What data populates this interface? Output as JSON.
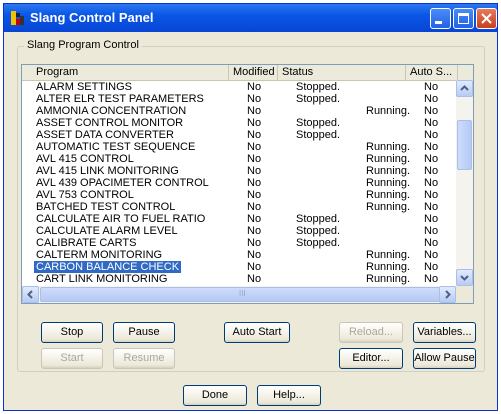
{
  "window": {
    "title": "Slang Control Panel"
  },
  "group": {
    "label": "Slang Program Control"
  },
  "table": {
    "columns": [
      "Program",
      "Modified",
      "Status",
      "Auto S..."
    ],
    "rows": [
      {
        "program": "ALARM SETTINGS",
        "modified": "No",
        "stopped": "Stopped.",
        "running": "",
        "auto": "No"
      },
      {
        "program": "ALTER ELR TEST PARAMETERS",
        "modified": "No",
        "stopped": "Stopped.",
        "running": "",
        "auto": "No"
      },
      {
        "program": "AMMONIA CONCENTRATION",
        "modified": "No",
        "stopped": "",
        "running": "Running.",
        "auto": "No"
      },
      {
        "program": "ASSET CONTROL MONITOR",
        "modified": "No",
        "stopped": "Stopped.",
        "running": "",
        "auto": "No"
      },
      {
        "program": "ASSET DATA CONVERTER",
        "modified": "No",
        "stopped": "Stopped.",
        "running": "",
        "auto": "No"
      },
      {
        "program": "AUTOMATIC TEST SEQUENCE",
        "modified": "No",
        "stopped": "",
        "running": "Running.",
        "auto": "No"
      },
      {
        "program": "AVL 415 CONTROL",
        "modified": "No",
        "stopped": "",
        "running": "Running.",
        "auto": "No"
      },
      {
        "program": "AVL 415 LINK MONITORING",
        "modified": "No",
        "stopped": "",
        "running": "Running.",
        "auto": "No"
      },
      {
        "program": "AVL 439 OPACIMETER CONTROL",
        "modified": "No",
        "stopped": "",
        "running": "Running.",
        "auto": "No"
      },
      {
        "program": "AVL 753 CONTROL",
        "modified": "No",
        "stopped": "",
        "running": "Running.",
        "auto": "No"
      },
      {
        "program": "BATCHED TEST CONTROL",
        "modified": "No",
        "stopped": "",
        "running": "Running.",
        "auto": "No"
      },
      {
        "program": "CALCULATE AIR TO FUEL RATIO",
        "modified": "No",
        "stopped": "Stopped.",
        "running": "",
        "auto": "No"
      },
      {
        "program": "CALCULATE ALARM LEVEL",
        "modified": "No",
        "stopped": "Stopped.",
        "running": "",
        "auto": "No"
      },
      {
        "program": "CALIBRATE CARTS",
        "modified": "No",
        "stopped": "Stopped.",
        "running": "",
        "auto": "No"
      },
      {
        "program": "CALTERM MONITORING",
        "modified": "No",
        "stopped": "",
        "running": "Running.",
        "auto": "No"
      },
      {
        "program": "CARBON BALANCE CHECK",
        "modified": "No",
        "stopped": "",
        "running": "Running.",
        "auto": "No"
      },
      {
        "program": "CART LINK MONITORING",
        "modified": "No",
        "stopped": "",
        "running": "Running.",
        "auto": "No"
      }
    ],
    "selected_index": 15
  },
  "scrollbar": {
    "h_grip": "III"
  },
  "buttons": {
    "stop": "Stop",
    "pause": "Pause",
    "auto_start": "Auto Start",
    "reload": "Reload...",
    "variables": "Variables...",
    "start": "Start",
    "resume": "Resume",
    "editor": "Editor...",
    "allow_pause": "Allow Pause",
    "done": "Done",
    "help": "Help..."
  },
  "colors": {
    "titlebar": "#0a56e6",
    "selection": "#316ac5",
    "face": "#ece9d8"
  }
}
